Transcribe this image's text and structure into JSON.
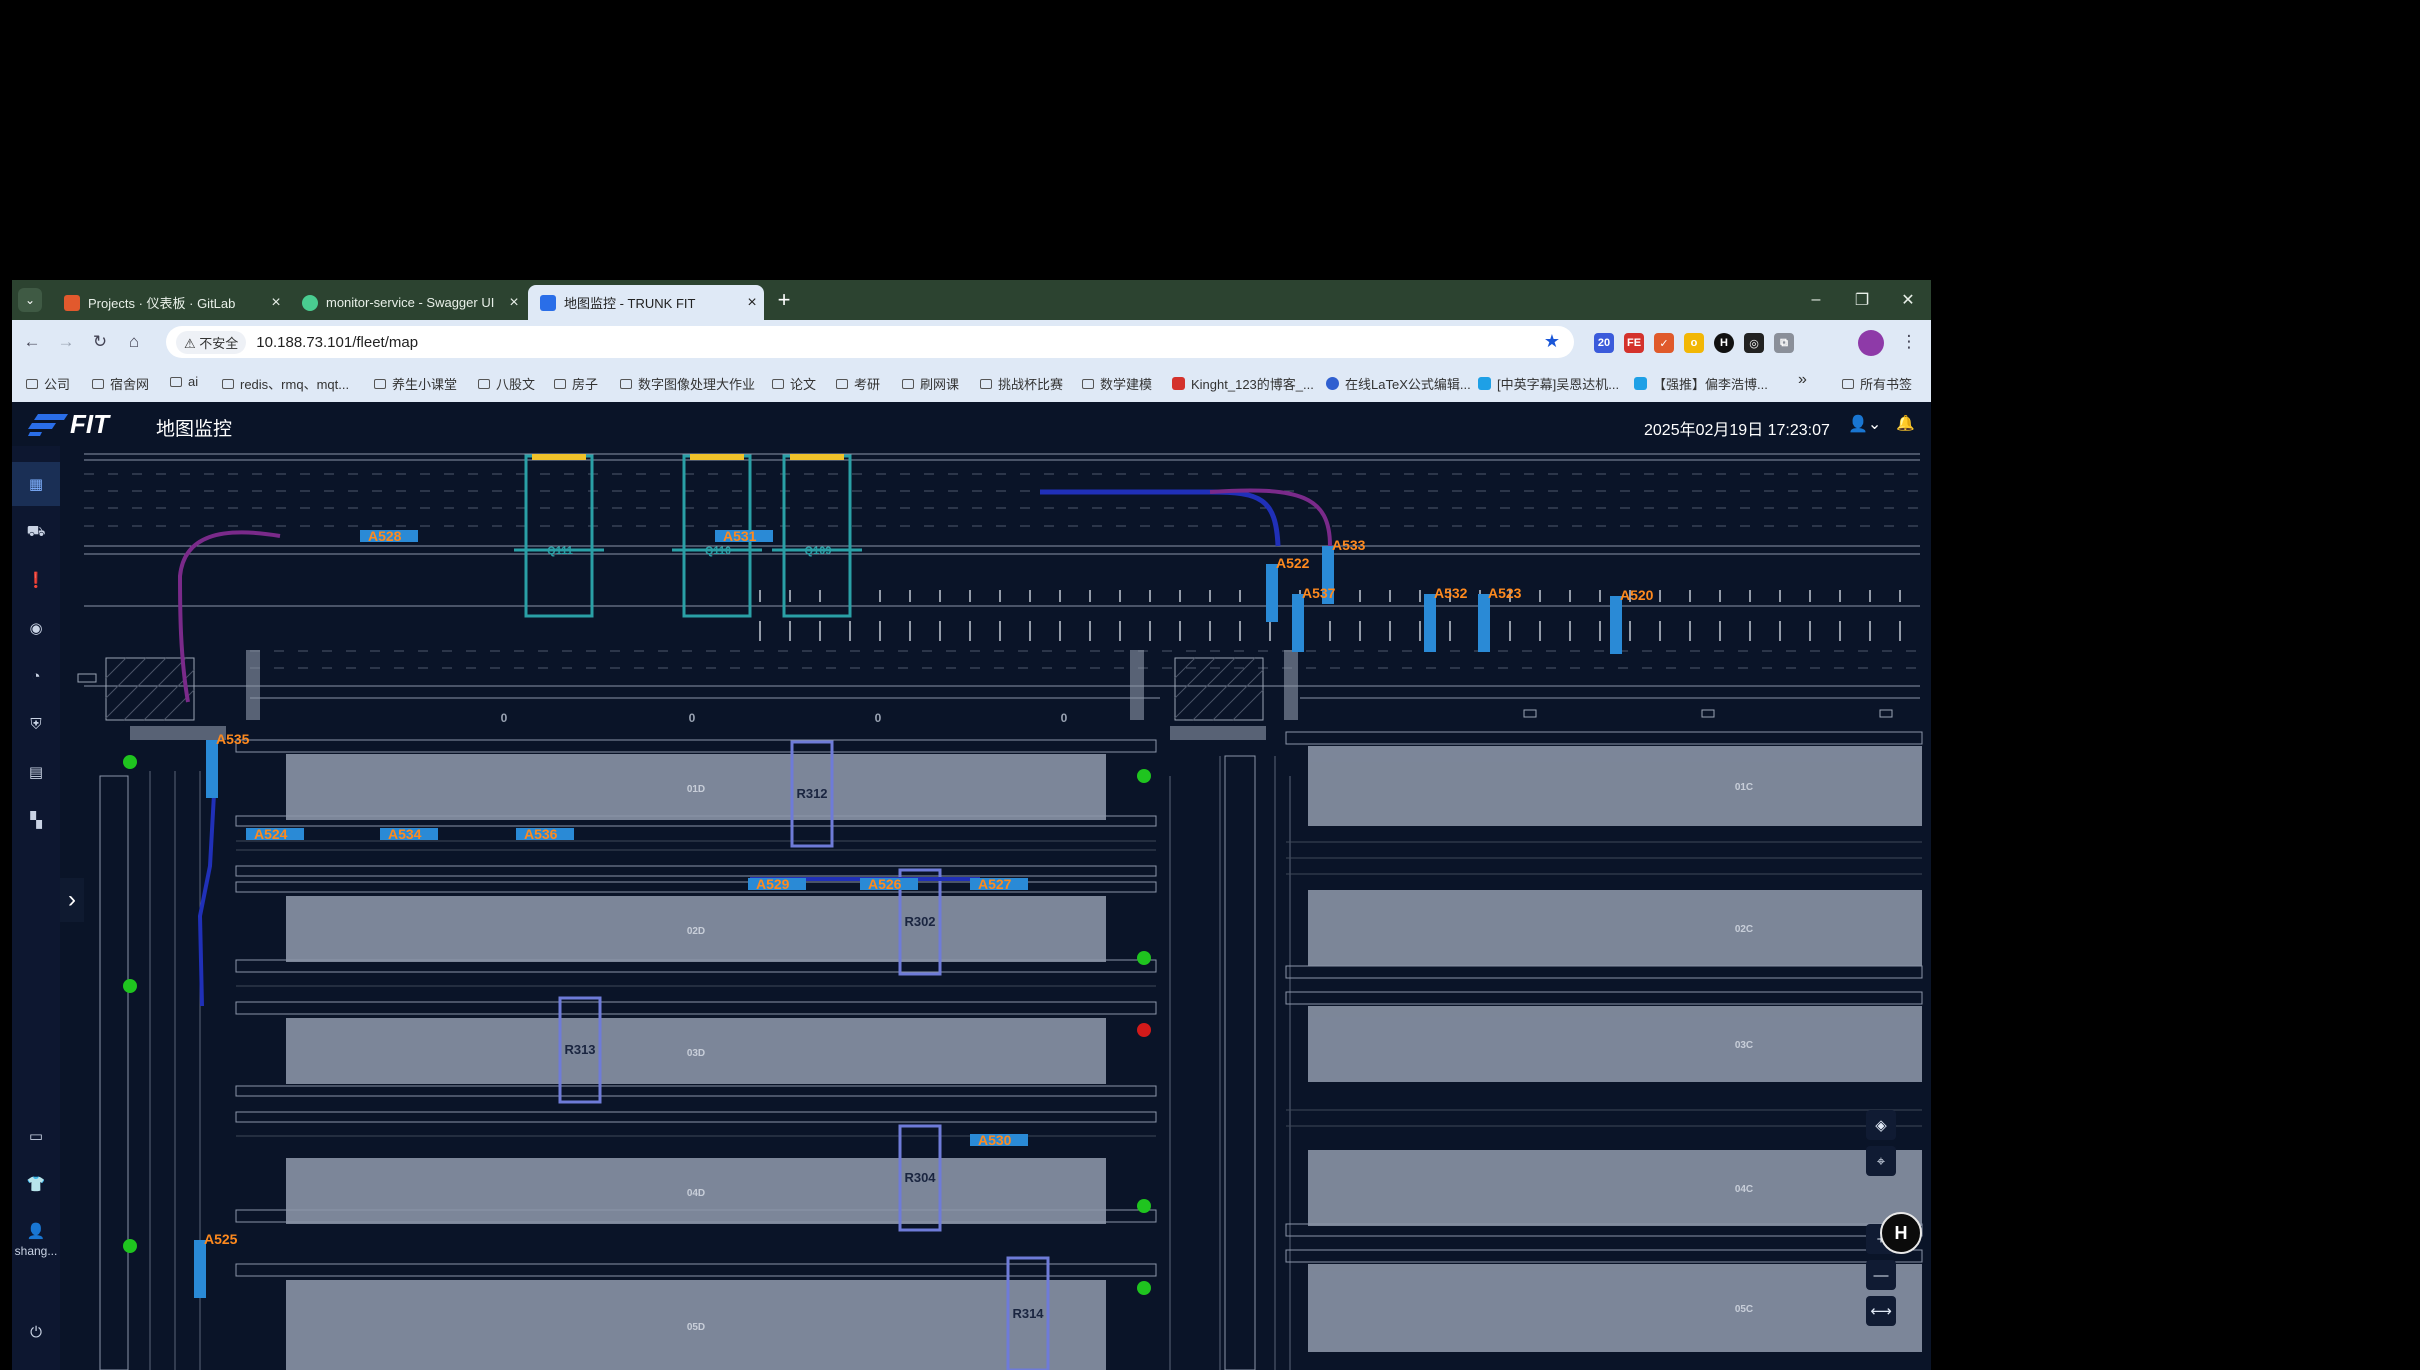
{
  "browser": {
    "tabs": [
      {
        "title": "Projects · 仪表板 · GitLab",
        "color": "#e2592d"
      },
      {
        "title": "monitor-service - Swagger UI",
        "color": "#49cc90"
      },
      {
        "title": "地图监控 - TRUNK FIT",
        "color": "#2a6ee8"
      }
    ],
    "new_tab": "+",
    "window_controls": [
      "–",
      "❐",
      "✕"
    ],
    "security_label": "⚠ 不安全",
    "url": "10.188.73.101/fleet/map",
    "extensions": [
      {
        "label": "20",
        "color": "#3b5bdb"
      },
      {
        "label": "FE",
        "color": "#d4322c"
      },
      {
        "label": "✓",
        "color": "#e05a2b"
      },
      {
        "label": "o",
        "color": "#f2b705"
      },
      {
        "label": "H",
        "color": "#111111"
      },
      {
        "label": "◎",
        "color": "#222222"
      },
      {
        "label": "⧉",
        "color": "#8a8f99"
      }
    ],
    "bookmarks": [
      {
        "label": "公司",
        "type": "folder"
      },
      {
        "label": "宿舍网",
        "type": "folder"
      },
      {
        "label": "ai",
        "type": "folder"
      },
      {
        "label": "redis、rmq、mqt...",
        "type": "folder"
      },
      {
        "label": "养生小课堂",
        "type": "folder"
      },
      {
        "label": "八股文",
        "type": "folder"
      },
      {
        "label": "房子",
        "type": "folder"
      },
      {
        "label": "数字图像处理大作业",
        "type": "folder"
      },
      {
        "label": "论文",
        "type": "folder"
      },
      {
        "label": "考研",
        "type": "folder"
      },
      {
        "label": "刷网课",
        "type": "folder"
      },
      {
        "label": "挑战杯比赛",
        "type": "folder"
      },
      {
        "label": "数学建模",
        "type": "folder"
      },
      {
        "label": "Kinght_123的博客_...",
        "type": "site",
        "color": "#d4322c"
      },
      {
        "label": "在线LaTeX公式编辑...",
        "type": "site",
        "color": "#2f5fd0"
      },
      {
        "label": "[中英字幕]吴恩达机...",
        "type": "site",
        "color": "#1ea0e6"
      },
      {
        "label": "【强推】偏李浩博...",
        "type": "site",
        "color": "#1ea0e6"
      }
    ],
    "bookmarks_more": "»",
    "all_bookmarks": "所有书签"
  },
  "app": {
    "logo": "FIT",
    "page_title": "地图监控",
    "datetime": "2025年02月19日 17:23:07",
    "sidebar_user": "shang...",
    "expand_arrow": "›"
  },
  "map": {
    "vehicles": [
      {
        "id": "A528"
      },
      {
        "id": "A531"
      },
      {
        "id": "A522"
      },
      {
        "id": "A533"
      },
      {
        "id": "A537"
      },
      {
        "id": "A532"
      },
      {
        "id": "A523"
      },
      {
        "id": "A520"
      },
      {
        "id": "A535"
      },
      {
        "id": "A524"
      },
      {
        "id": "A534"
      },
      {
        "id": "A536"
      },
      {
        "id": "A529"
      },
      {
        "id": "A526"
      },
      {
        "id": "A527"
      },
      {
        "id": "A530"
      },
      {
        "id": "A525"
      }
    ],
    "cranes": [
      "Q111",
      "Q110",
      "Q109"
    ],
    "rtgs": [
      "R312",
      "R302",
      "R313",
      "R304",
      "R314"
    ],
    "yard_blocks": [
      "01D",
      "02D",
      "03D",
      "04D",
      "05D",
      "01C",
      "02C",
      "03C",
      "04C",
      "05C"
    ],
    "lane_markers": [
      "0",
      "0",
      "0",
      "0"
    ]
  }
}
